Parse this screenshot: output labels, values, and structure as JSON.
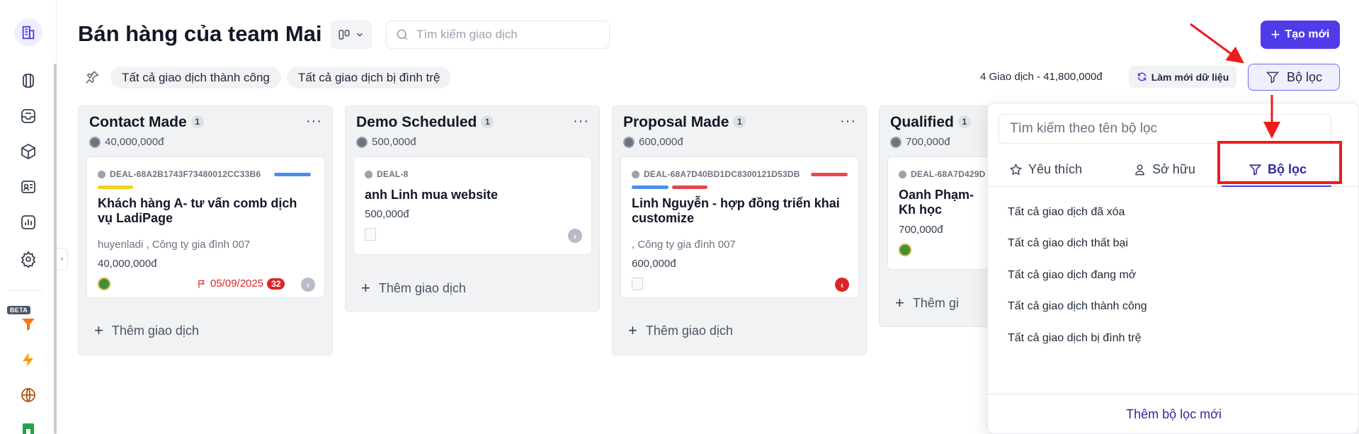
{
  "page": {
    "title": "Bán hàng của team Mai",
    "search_placeholder": "Tìm kiếm giao dịch",
    "create_button": "Tạo mới"
  },
  "sidebar": {
    "beta_label": "BETA",
    "icons": [
      "building-icon",
      "pipeline-icon",
      "inbox-icon",
      "box-icon",
      "contact-card-icon",
      "chart-icon",
      "gear-icon",
      "funnel-icon",
      "lightning-icon",
      "globe-icon",
      "store-icon"
    ]
  },
  "filters": {
    "chips": [
      "Tất cả giao dịch thành công",
      "Tất cả giao dịch bị đình trệ"
    ],
    "summary": "4 Giao dịch - 41,800,000đ",
    "refresh_button": "Làm mới dữ liệu",
    "filter_button": "Bộ lọc"
  },
  "columns": [
    {
      "title": "Contact Made",
      "count": "1",
      "amount": "40,000,000đ",
      "card": {
        "deal_id": "DEAL-68A2B1743F73480012CC33B6",
        "title": "Khách hàng A- tư vấn comb dịch vụ LadiPage",
        "meta": "huyenladi , Công ty gia đình 007",
        "money": "40,000,000đ",
        "due_date": "05/09/2025",
        "due_count": "32",
        "tag_colors": [
          "#4b8ef1",
          "#f2d21d"
        ]
      },
      "add_label": "Thêm giao dịch"
    },
    {
      "title": "Demo Scheduled",
      "count": "1",
      "amount": "500,000đ",
      "card": {
        "deal_id": "DEAL-8",
        "title": "anh Linh mua website",
        "money": "500,000đ"
      },
      "add_label": "Thêm giao dịch"
    },
    {
      "title": "Proposal Made",
      "count": "1",
      "amount": "600,000đ",
      "card": {
        "deal_id": "DEAL-68A7D40BD1DC8300121D53DB",
        "title": "Linh Nguyễn - hợp đồng triển khai customize",
        "meta": ", Công ty gia đình 007",
        "money": "600,000đ",
        "tag_colors": [
          "#e5484d",
          "#4b8ef1",
          "#e5484d"
        ]
      },
      "add_label": "Thêm giao dịch"
    },
    {
      "title": "Qualified",
      "count": "1",
      "amount": "700,000đ",
      "card": {
        "deal_id": "DEAL-68A7D429D",
        "title": "Oanh Phạm- Kh học",
        "money": "700,000đ"
      },
      "add_label": "Thêm gi"
    }
  ],
  "dropdown": {
    "search_placeholder": "Tìm kiếm theo tên bộ lọc",
    "tabs": [
      "Yêu thích",
      "Sở hữu",
      "Bộ lọc"
    ],
    "active_tab": "Bộ lọc",
    "items": [
      "Tất cả giao dịch đã xóa",
      "Tất cả giao dịch thất bại",
      "Tất cả giao dịch đang mở",
      "Tất cả giao dịch thành công",
      "Tất cả giao dịch bị đình trệ"
    ],
    "footer": "Thêm bộ lọc mới"
  },
  "colors": {
    "primary": "#4f3ce8",
    "annotation": "#ef1c1c",
    "danger": "#dc2626"
  }
}
